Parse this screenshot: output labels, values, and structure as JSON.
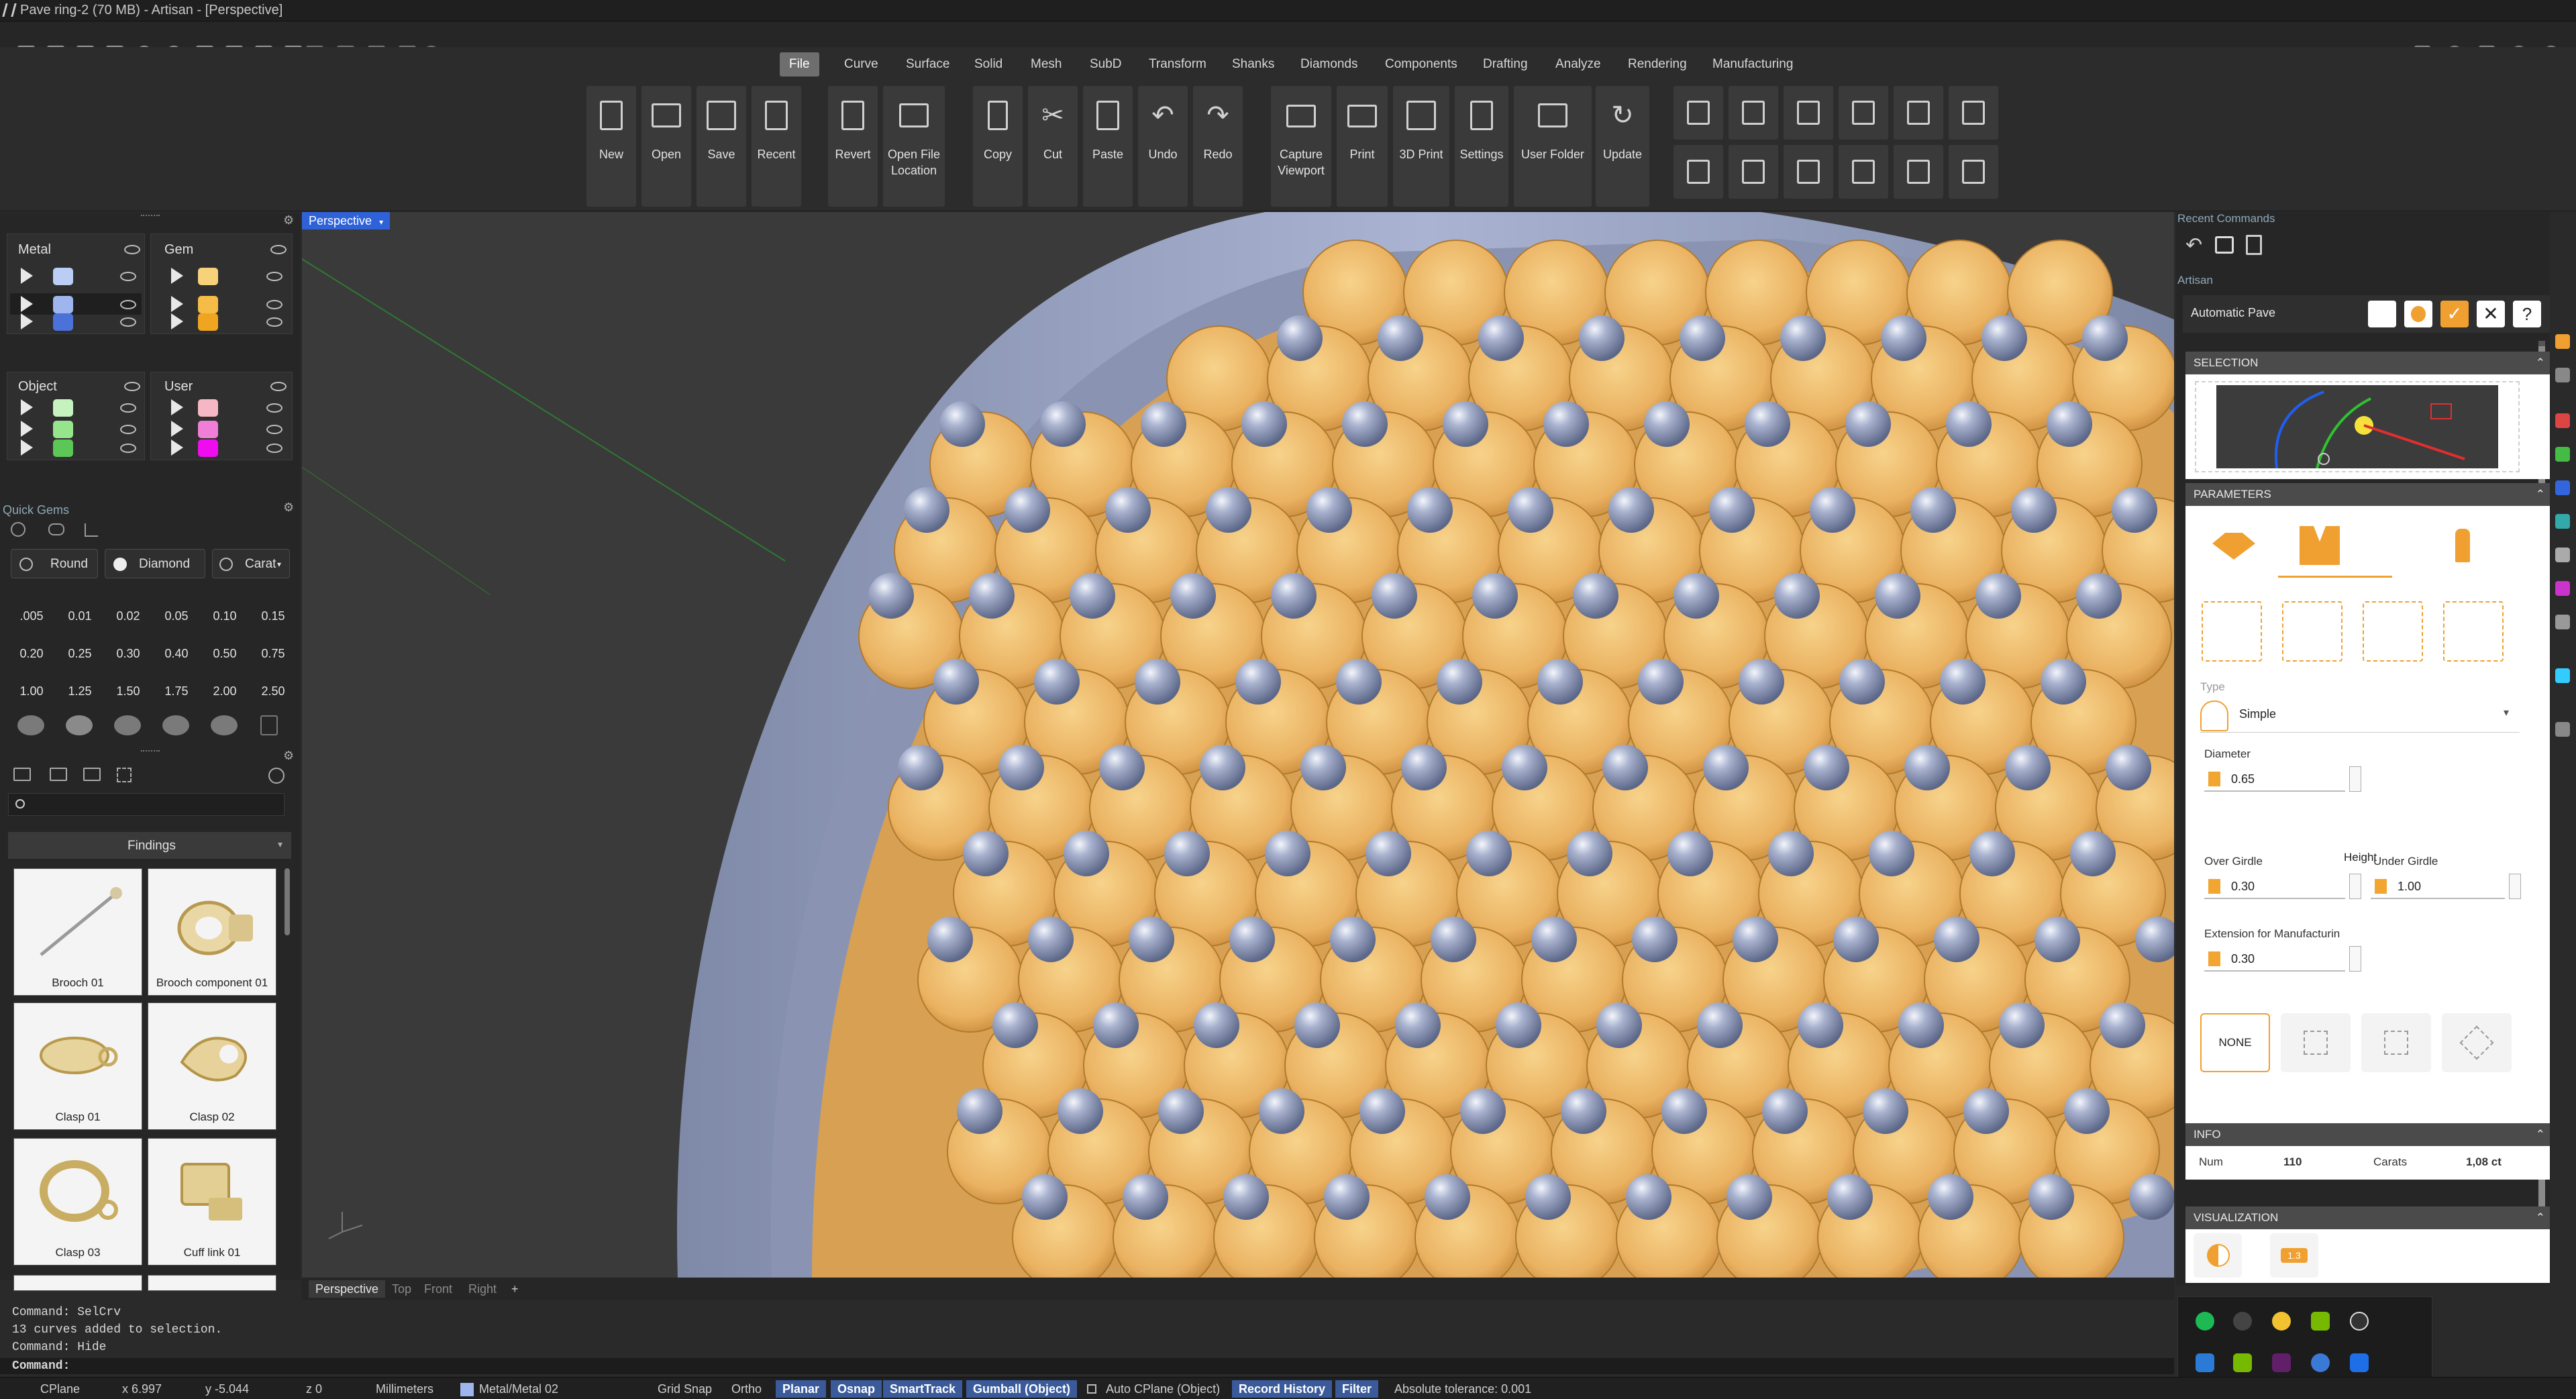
{
  "window": {
    "title": "Pave ring-2 (70 MB) - Artisan - [Perspective]"
  },
  "menu_tabs": [
    "File",
    "Curve",
    "Surface",
    "Solid",
    "Mesh",
    "SubD",
    "Transform",
    "Shanks",
    "Diamonds",
    "Components",
    "Drafting",
    "Analyze",
    "Rendering",
    "Manufacturing"
  ],
  "ribbon_buttons": {
    "new": "New",
    "open": "Open",
    "save": "Save",
    "recent": "Recent",
    "revert": "Revert",
    "open_file_location_1": "Open File",
    "open_file_location_2": "Location",
    "copy": "Copy",
    "cut": "Cut",
    "paste": "Paste",
    "undo": "Undo",
    "redo": "Redo",
    "capture_1": "Capture",
    "capture_2": "Viewport",
    "print": "Print",
    "print3d": "3D Print",
    "settings": "Settings",
    "user_folder": "User Folder",
    "update": "Update"
  },
  "layers": {
    "metal": "Metal",
    "gem": "Gem",
    "object": "Object",
    "user": "User",
    "metal_colors": [
      "#b9cdf5",
      "#9fb5ee",
      "#4a72d8"
    ],
    "gem_colors": [
      "#f8d27a",
      "#f5bd48",
      "#f0a520"
    ],
    "object_colors": [
      "#c6f2c0",
      "#96e58c",
      "#5cc656"
    ],
    "user_colors": [
      "#f6b7c4",
      "#f07ed6",
      "#ef0df0"
    ]
  },
  "quick_gems": {
    "title": "Quick Gems",
    "shape": "Round",
    "material": "Diamond",
    "unit": "Carat",
    "carats": [
      ".005",
      "0.01",
      "0.02",
      "0.05",
      "0.10",
      "0.15",
      "0.20",
      "0.25",
      "0.30",
      "0.40",
      "0.50",
      "0.75",
      "1.00",
      "1.25",
      "1.50",
      "1.75",
      "2.00",
      "2.50"
    ]
  },
  "library": {
    "category": "Findings",
    "items": [
      "Brooch 01",
      "Brooch component 01",
      "Clasp 01",
      "Clasp 02",
      "Clasp 03",
      "Cuff link 01"
    ]
  },
  "viewport": {
    "name": "Perspective",
    "tabs": [
      "Perspective",
      "Top",
      "Front",
      "Right"
    ],
    "add": "+"
  },
  "right_panel": {
    "recent_commands": "Recent Commands",
    "artisan": "Artisan",
    "command_name": "Automatic Pave",
    "selection": "SELECTION",
    "parameters": "PARAMETERS",
    "type_label": "Type",
    "type_value": "Simple",
    "diameter_label": "Diameter",
    "diameter_value": "0.65",
    "height_label": "Height",
    "over_girdle_label": "Over Girdle",
    "over_girdle_value": "0.30",
    "under_girdle_label": "Under Girdle",
    "under_girdle_value": "1.00",
    "extension_label": "Extension for Manufacturin",
    "extension_value": "0.30",
    "none_label": "NONE",
    "info": "INFO",
    "num_label": "Num",
    "num_value": "110",
    "carats_label": "Carats",
    "carats_value": "1,08 ct",
    "visualization": "VISUALIZATION",
    "vis_badge": "1.3"
  },
  "command_history": [
    "Command: SelCrv",
    "13 curves added to selection.",
    "Command: Hide"
  ],
  "command_prompt": "Command:",
  "status": {
    "cplane": "CPlane",
    "x": "x 6.997",
    "y": "y -5.044",
    "z": "z 0",
    "units": "Millimeters",
    "layer": "Metal/Metal 02",
    "grid_snap": "Grid Snap",
    "ortho": "Ortho",
    "planar": "Planar",
    "osnap": "Osnap",
    "smarttrack": "SmartTrack",
    "gumball": "Gumball (Object)",
    "auto_cplane": "Auto CPlane (Object)",
    "record_history": "Record History",
    "filter": "Filter",
    "tolerance": "Absolute tolerance: 0.001"
  },
  "colors": {
    "accent_blue": "#2f62d8",
    "accent_orange": "#f0a030",
    "metal": "#9aa8c8",
    "gem": "#efbf6a"
  }
}
